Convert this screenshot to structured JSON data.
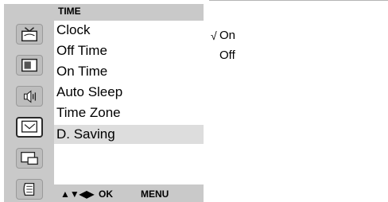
{
  "menu": {
    "title": "TIME",
    "items": [
      {
        "label": "Clock"
      },
      {
        "label": "Off Time"
      },
      {
        "label": "On Time"
      },
      {
        "label": "Auto Sleep"
      },
      {
        "label": "Time Zone"
      },
      {
        "label": "D. Saving"
      }
    ],
    "selected_index": 5,
    "footer": {
      "arrows": "▲▼◀▶",
      "ok": "OK",
      "menu": "MENU"
    }
  },
  "sidebar": {
    "icons": [
      {
        "name": "tv-antenna-icon"
      },
      {
        "name": "picture-icon"
      },
      {
        "name": "audio-icon"
      },
      {
        "name": "clock-icon",
        "active": true
      },
      {
        "name": "pip-icon"
      },
      {
        "name": "setup-icon"
      }
    ]
  },
  "options": {
    "check_mark": "√",
    "items": [
      {
        "label": "On",
        "checked": true
      },
      {
        "label": "Off",
        "checked": false
      }
    ]
  },
  "colors": {
    "panel": "#c9c9c9",
    "highlight": "#dddddd"
  }
}
